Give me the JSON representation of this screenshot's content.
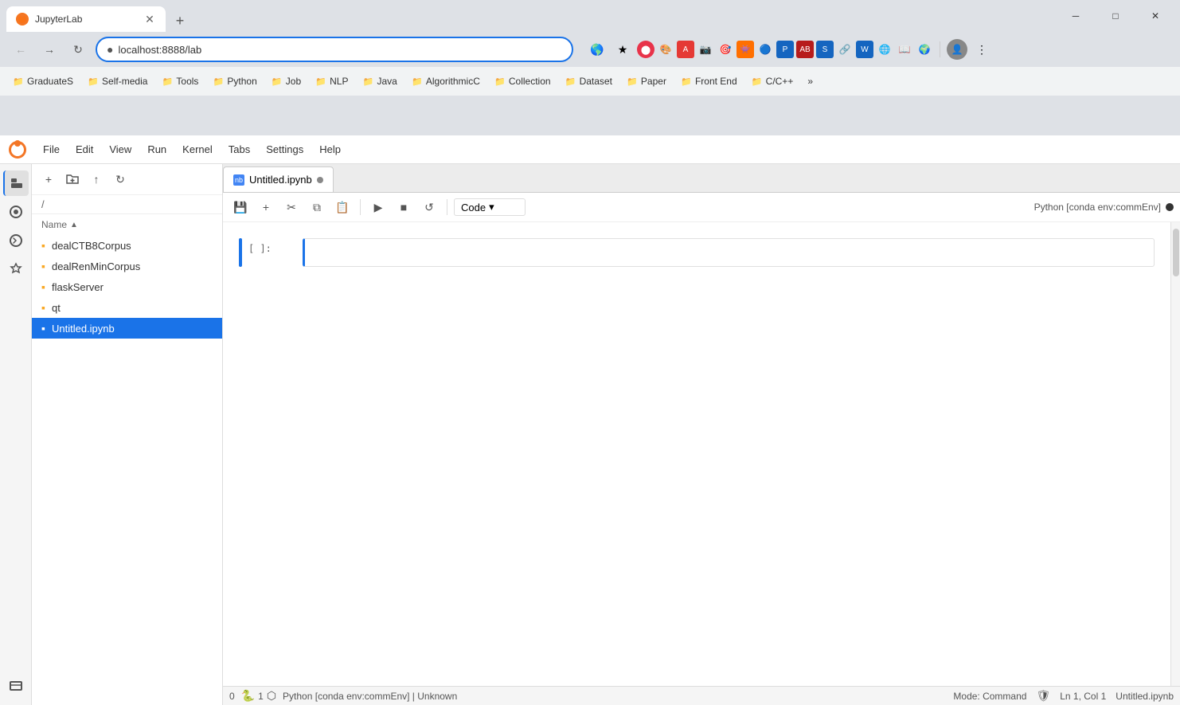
{
  "browser": {
    "tab_title": "JupyterLab",
    "tab_favicon": "J",
    "url": "localhost:8888/lab",
    "new_tab_label": "+",
    "window_controls": {
      "minimize": "─",
      "maximize": "□",
      "close": "✕"
    }
  },
  "bookmarks": [
    {
      "label": "GraduateS",
      "icon": "📁"
    },
    {
      "label": "Self-media",
      "icon": "📁"
    },
    {
      "label": "Tools",
      "icon": "📁"
    },
    {
      "label": "Python",
      "icon": "📁"
    },
    {
      "label": "Job",
      "icon": "📁"
    },
    {
      "label": "NLP",
      "icon": "📁"
    },
    {
      "label": "Java",
      "icon": "📁"
    },
    {
      "label": "AlgorithmicC",
      "icon": "📁"
    },
    {
      "label": "Collection",
      "icon": "📁"
    },
    {
      "label": "Dataset",
      "icon": "📁"
    },
    {
      "label": "Paper",
      "icon": "📁"
    },
    {
      "label": "Front End",
      "icon": "📁"
    },
    {
      "label": "C/C++",
      "icon": "📁"
    }
  ],
  "menu": {
    "items": [
      "File",
      "Edit",
      "View",
      "Run",
      "Kernel",
      "Tabs",
      "Settings",
      "Help"
    ]
  },
  "file_browser": {
    "path": "/",
    "header": "Name",
    "files": [
      {
        "name": "dealCTB8Corpus",
        "type": "folder"
      },
      {
        "name": "dealRenMinCorpus",
        "type": "folder"
      },
      {
        "name": "flaskServer",
        "type": "folder"
      },
      {
        "name": "qt",
        "type": "folder"
      },
      {
        "name": "Untitled.ipynb",
        "type": "notebook",
        "active": true
      }
    ]
  },
  "notebook": {
    "tab_name": "Untitled.ipynb",
    "cell_type": "Code",
    "kernel_name": "Python [conda env:commEnv]",
    "cell_prompt": "[ ]:",
    "cell_content": ""
  },
  "status_bar": {
    "left": "0",
    "kernel": "Python [conda env:commEnv] | Unknown",
    "mode": "Mode: Command",
    "position": "Ln 1, Col 1",
    "filename": "Untitled.ipynb"
  }
}
